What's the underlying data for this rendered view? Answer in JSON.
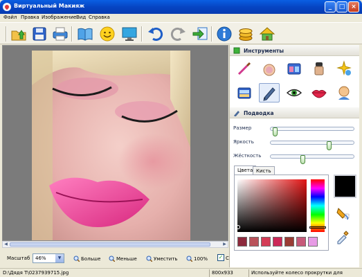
{
  "window": {
    "title": "Виртуальный Макияж",
    "controls": [
      "_",
      "□",
      "×"
    ]
  },
  "menu": [
    "Файл",
    "Правка",
    "Изображение",
    "Вид",
    "Справка"
  ],
  "toolbar": {
    "tools": [
      "open-folder-icon",
      "save-icon",
      "print-icon",
      "book-icon",
      "smiley-icon",
      "monitor-icon",
      "undo-icon",
      "redo-icon",
      "export-icon",
      "info-icon",
      "coins-icon",
      "home-icon"
    ]
  },
  "panel": {
    "instruments_title": "Инструменты",
    "instrument_tools": [
      "brush-icon",
      "powder-icon",
      "palette-icon",
      "foundation-icon",
      "sparkle-icon",
      "eyeshadow-icon",
      "pencil-icon",
      "eye-icon",
      "lips-icon",
      "face-icon"
    ],
    "selected_tool": "pencil-icon",
    "liner_title": "Подводка",
    "sliders": [
      {
        "label": "Размер",
        "value": 0.03
      },
      {
        "label": "Яркость",
        "value": 0.72
      },
      {
        "label": "Жёсткость",
        "value": 0.38
      }
    ],
    "tabs": [
      "Цвета",
      "Кисть"
    ],
    "active_tab": "Цвета",
    "swatch_colors": [
      "#8d2a3d",
      "#b9525a",
      "#d43d56",
      "#cc2958",
      "#9a3c34",
      "#c75a7a",
      "#e79be5"
    ],
    "current_color": "#000000"
  },
  "zoombar": {
    "label": "Масштаб",
    "zoom_value": "46%",
    "bigger": "Больше",
    "smaller": "Меньше",
    "fit": "Уместить",
    "actual": "100%",
    "checkbox_label": "С"
  },
  "status": {
    "path": "D:\\Дядя Т\\0237939715.jpg",
    "dimensions": "800x933",
    "hint": "Используйте колесо прокрутки для изменения"
  }
}
